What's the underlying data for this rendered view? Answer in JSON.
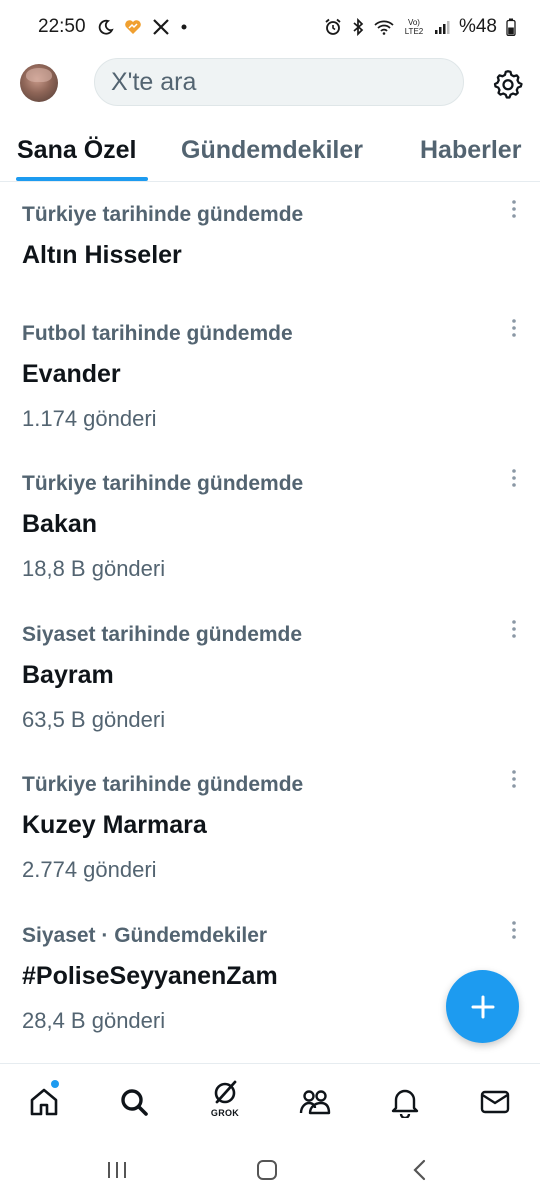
{
  "status_bar": {
    "time": "22:50",
    "battery_text": "%48",
    "network_label": "Vo) LTE2"
  },
  "top_bar": {
    "search_placeholder": "X'te ara"
  },
  "tabs": [
    {
      "label": "Sana Özel",
      "active": true
    },
    {
      "label": "Gündemdekiler",
      "active": false
    },
    {
      "label": "Haberler",
      "active": false
    }
  ],
  "trends": [
    {
      "context": "Türkiye tarihinde gündemde",
      "title": "Altın Hisseler",
      "count": ""
    },
    {
      "context": "Futbol tarihinde gündemde",
      "title": "Evander",
      "count": "1.174 gönderi"
    },
    {
      "context": "Türkiye tarihinde gündemde",
      "title": "Bakan",
      "count": "18,8 B gönderi"
    },
    {
      "context": "Siyaset tarihinde gündemde",
      "title": "Bayram",
      "count": "63,5 B gönderi"
    },
    {
      "context": "Türkiye tarihinde gündemde",
      "title": "Kuzey Marmara",
      "count": "2.774 gönderi"
    },
    {
      "context": "Siyaset · Gündemdekiler",
      "title": "#PoliseSeyyanenZam",
      "count": "28,4 B gönderi"
    }
  ],
  "bottom_nav": {
    "grok_label": "GROK",
    "items": [
      "home-icon",
      "search-icon",
      "grok-icon",
      "communities-icon",
      "notifications-icon",
      "messages-icon"
    ]
  },
  "colors": {
    "accent": "#1d9bf0",
    "text_primary": "#0f1419",
    "text_secondary": "#536471"
  }
}
